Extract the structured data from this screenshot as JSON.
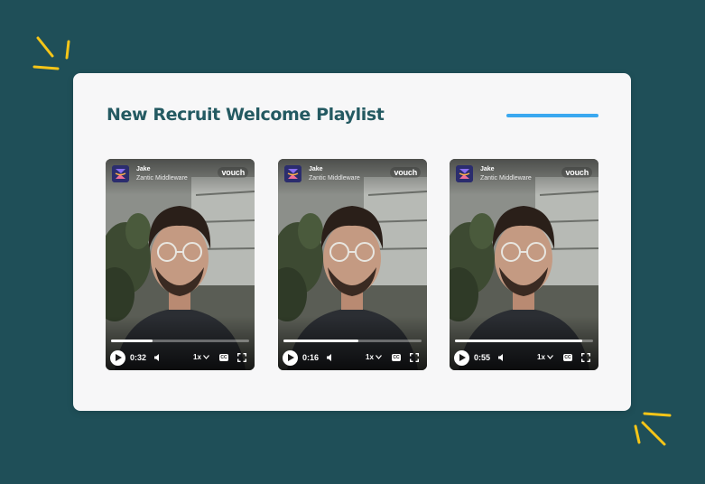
{
  "playlist": {
    "title": "New Recruit Welcome Playlist"
  },
  "colors": {
    "background": "#1f4f58",
    "card": "#f7f7f8",
    "title": "#245a62",
    "accent": "#3aa8f0",
    "spark": "#f5c518"
  },
  "videos": [
    {
      "person": "Jake",
      "company": "Zantic Middleware",
      "brand": "vouch",
      "time": "0:32",
      "progress": 0.3,
      "speed": "1x",
      "cc": "CC"
    },
    {
      "person": "Jake",
      "company": "Zantic Middleware",
      "brand": "vouch",
      "time": "0:16",
      "progress": 0.54,
      "speed": "1x",
      "cc": "CC"
    },
    {
      "person": "Jake",
      "company": "Zantic Middleware",
      "brand": "vouch",
      "time": "0:55",
      "progress": 0.92,
      "speed": "1x",
      "cc": "CC"
    }
  ],
  "icons": [
    "play-icon",
    "volume-icon",
    "chevron-down-icon",
    "closed-captions-icon",
    "fullscreen-icon",
    "sparkle-icon"
  ]
}
